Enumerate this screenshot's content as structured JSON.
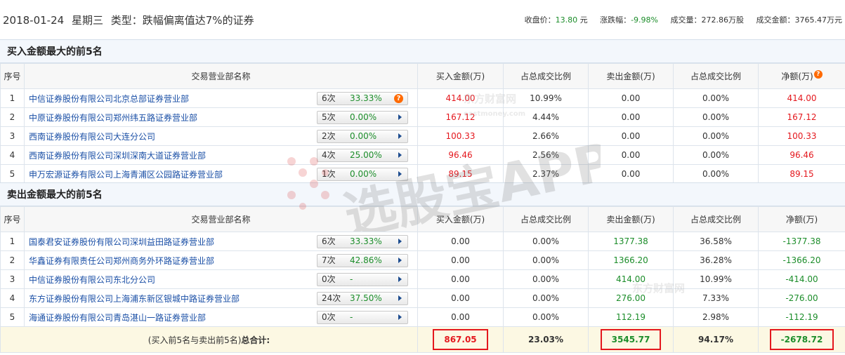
{
  "header": {
    "date": "2018-01-24",
    "weekday": "星期三",
    "type_label": "类型：跌幅偏离值达7%的证券",
    "close_label": "收盘价：",
    "close_value": "13.80",
    "close_unit": "元",
    "change_label": "涨跌幅：",
    "change_value": "-9.98%",
    "volume_label": "成交量：",
    "volume_value": "272.86万股",
    "amount_label": "成交金额：",
    "amount_value": "3765.47万元"
  },
  "buy_section": {
    "title": "买入金额最大的前5名",
    "columns": [
      "序号",
      "交易营业部名称",
      "买入金额(万)",
      "占总成交比例",
      "卖出金额(万)",
      "占总成交比例",
      "净额(万)"
    ],
    "rows": [
      {
        "no": "1",
        "name": "中信证券股份有限公司北京总部证券营业部",
        "count": "6次",
        "pct": "33.33%",
        "buy": "414.00",
        "buy_ratio": "10.99%",
        "sell": "0.00",
        "sell_ratio": "0.00%",
        "net": "414.00"
      },
      {
        "no": "2",
        "name": "中原证券股份有限公司郑州纬五路证券营业部",
        "count": "5次",
        "pct": "0.00%",
        "buy": "167.12",
        "buy_ratio": "4.44%",
        "sell": "0.00",
        "sell_ratio": "0.00%",
        "net": "167.12"
      },
      {
        "no": "3",
        "name": "西南证券股份有限公司大连分公司",
        "count": "2次",
        "pct": "0.00%",
        "buy": "100.33",
        "buy_ratio": "2.66%",
        "sell": "0.00",
        "sell_ratio": "0.00%",
        "net": "100.33"
      },
      {
        "no": "4",
        "name": "西南证券股份有限公司深圳深南大道证券营业部",
        "count": "4次",
        "pct": "25.00%",
        "buy": "96.46",
        "buy_ratio": "2.56%",
        "sell": "0.00",
        "sell_ratio": "0.00%",
        "net": "96.46"
      },
      {
        "no": "5",
        "name": "申万宏源证券有限公司上海青浦区公园路证券营业部",
        "count": "1次",
        "pct": "0.00%",
        "buy": "89.15",
        "buy_ratio": "2.37%",
        "sell": "0.00",
        "sell_ratio": "0.00%",
        "net": "89.15"
      }
    ]
  },
  "sell_section": {
    "title": "卖出金额最大的前5名",
    "columns": [
      "序号",
      "交易营业部名称",
      "买入金额(万)",
      "占总成交比例",
      "卖出金额(万)",
      "占总成交比例",
      "净额(万)"
    ],
    "rows": [
      {
        "no": "1",
        "name": "国泰君安证券股份有限公司深圳益田路证券营业部",
        "count": "6次",
        "pct": "33.33%",
        "buy": "0.00",
        "buy_ratio": "0.00%",
        "sell": "1377.38",
        "sell_ratio": "36.58%",
        "net": "-1377.38"
      },
      {
        "no": "2",
        "name": "华鑫证券有限责任公司郑州商务外环路证券营业部",
        "count": "7次",
        "pct": "42.86%",
        "buy": "0.00",
        "buy_ratio": "0.00%",
        "sell": "1366.20",
        "sell_ratio": "36.28%",
        "net": "-1366.20"
      },
      {
        "no": "3",
        "name": "中信证券股份有限公司东北分公司",
        "count": "0次",
        "pct": "-",
        "buy": "0.00",
        "buy_ratio": "0.00%",
        "sell": "414.00",
        "sell_ratio": "10.99%",
        "net": "-414.00"
      },
      {
        "no": "4",
        "name": "东方证券股份有限公司上海浦东新区银城中路证券营业部",
        "count": "24次",
        "pct": "37.50%",
        "buy": "0.00",
        "buy_ratio": "0.00%",
        "sell": "276.00",
        "sell_ratio": "7.33%",
        "net": "-276.00"
      },
      {
        "no": "5",
        "name": "海通证券股份有限公司青岛湛山一路证券营业部",
        "count": "0次",
        "pct": "-",
        "buy": "0.00",
        "buy_ratio": "0.00%",
        "sell": "112.19",
        "sell_ratio": "2.98%",
        "net": "-112.19"
      }
    ],
    "total": {
      "label_prefix": "(买入前5名与卖出前5名)",
      "label_bold": "总合计:",
      "buy": "867.05",
      "buy_ratio": "23.03%",
      "sell": "3545.77",
      "sell_ratio": "94.17%",
      "net": "-2678.72"
    }
  },
  "question_glyph": "?",
  "watermark": {
    "brand": "选股宝APP",
    "site": "东方财富网",
    "domain": "eastmoney.com"
  },
  "colors": {
    "up": "#e4181e",
    "down": "#1c8d2a",
    "link": "#1a4fa6",
    "highlight_box": "#e4181e"
  }
}
